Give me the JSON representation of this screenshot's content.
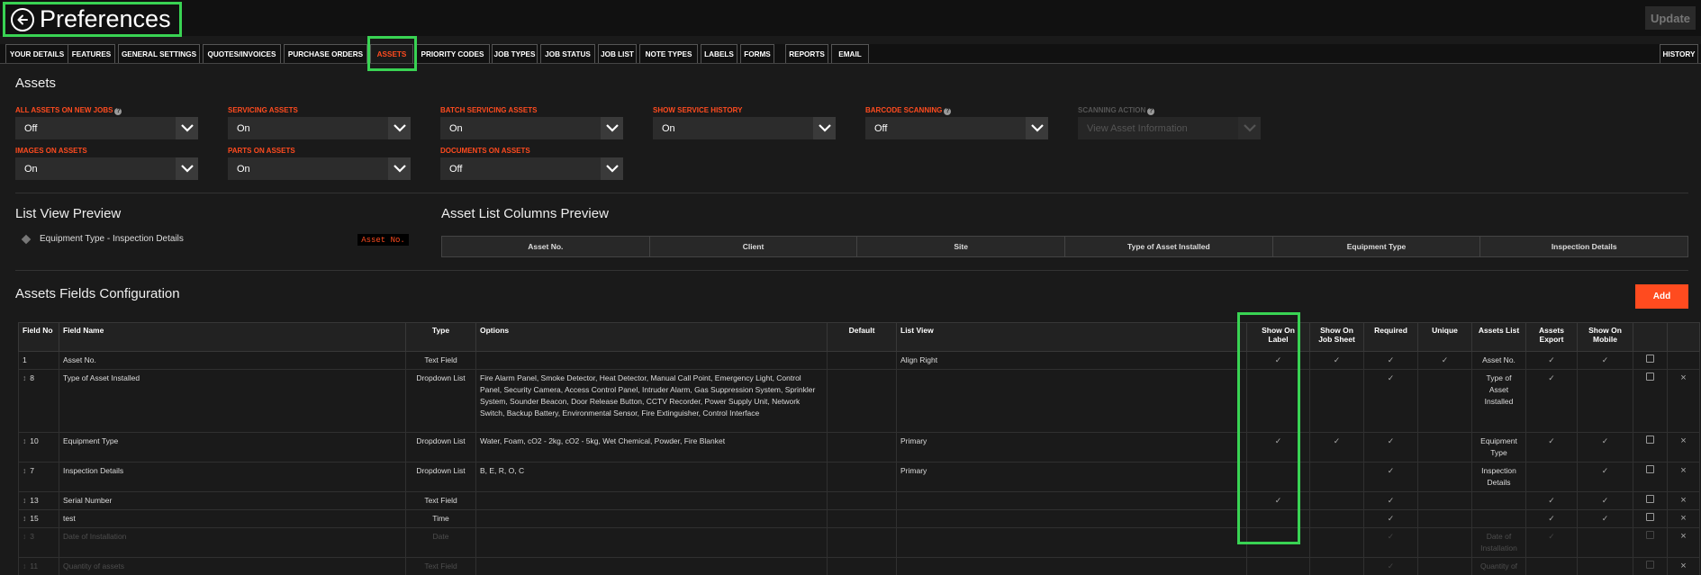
{
  "header": {
    "title": "Preferences",
    "update_label": "Update"
  },
  "tabs": [
    {
      "label": "YOUR DETAILS"
    },
    {
      "label": "FEATURES"
    },
    {
      "label": "GENERAL SETTINGS"
    },
    {
      "label": "QUOTES/INVOICES"
    },
    {
      "label": "PURCHASE ORDERS"
    },
    {
      "label": "ASSETS",
      "active": true
    },
    {
      "label": "PRIORITY CODES"
    },
    {
      "label": "JOB TYPES"
    },
    {
      "label": "JOB STATUS"
    },
    {
      "label": "JOB LIST"
    },
    {
      "label": "NOTE TYPES"
    },
    {
      "label": "LABELS"
    },
    {
      "label": "FORMS"
    },
    {
      "label": "REPORTS"
    },
    {
      "label": "EMAIL"
    }
  ],
  "history_label": "HISTORY",
  "assets_section": {
    "title": "Assets",
    "fields": [
      {
        "label": "ALL ASSETS ON NEW JOBS",
        "value": "Off",
        "help": true
      },
      {
        "label": "SERVICING ASSETS",
        "value": "On"
      },
      {
        "label": "BATCH SERVICING ASSETS",
        "value": "On"
      },
      {
        "label": "SHOW SERVICE HISTORY",
        "value": "On"
      },
      {
        "label": "BARCODE SCANNING",
        "value": "Off",
        "help": true
      },
      {
        "label": "SCANNING ACTION",
        "value": "View Asset Information",
        "help": true,
        "disabled": true
      },
      {
        "label": "IMAGES ON ASSETS",
        "value": "On"
      },
      {
        "label": "PARTS ON ASSETS",
        "value": "On"
      },
      {
        "label": "DOCUMENTS ON ASSETS",
        "value": "Off"
      }
    ]
  },
  "list_view_preview": {
    "title": "List View Preview",
    "item_text": "Equipment Type - Inspection Details",
    "badge": "Asset No."
  },
  "columns_preview": {
    "title": "Asset List Columns Preview",
    "columns": [
      "Asset No.",
      "Client",
      "Site",
      "Type of Asset Installed",
      "Equipment Type",
      "Inspection Details"
    ]
  },
  "config": {
    "title": "Assets Fields Configuration",
    "add_label": "Add",
    "headers": {
      "field_no": "Field No",
      "field_name": "Field Name",
      "type": "Type",
      "options": "Options",
      "default": "Default",
      "list_view": "List View",
      "show_on_label": "Show On Label",
      "show_on_job_sheet": "Show On Job Sheet",
      "required": "Required",
      "unique": "Unique",
      "assets_list": "Assets List",
      "assets_export": "Assets Export",
      "show_on_mobile": "Show On Mobile"
    },
    "rows": [
      {
        "no": "1",
        "name": "Asset No.",
        "type": "Text Field",
        "options": "",
        "default": "",
        "list_view": "Align Right",
        "label": true,
        "job_sheet": true,
        "required": true,
        "unique": true,
        "assets_list": "Asset No.",
        "export": true,
        "mobile": true,
        "drag": false,
        "delete": false,
        "dim": false
      },
      {
        "no": "8",
        "name": "Type of Asset Installed",
        "type": "Dropdown List",
        "options": "Fire Alarm Panel, Smoke Detector, Heat Detector, Manual Call Point, Emergency Light, Control Panel, Security Camera, Access Control Panel, Intruder Alarm, Gas Suppression System, Sprinkler System, Sounder Beacon, Door Release Button, CCTV Recorder, Power Supply Unit, Network Switch, Backup Battery, Environmental Sensor, Fire Extinguisher, Control Interface",
        "default": "",
        "list_view": "",
        "label": false,
        "job_sheet": false,
        "required": true,
        "unique": false,
        "assets_list": "Type of Asset Installed",
        "export": true,
        "mobile": false,
        "drag": true,
        "delete": true,
        "dim": false
      },
      {
        "no": "10",
        "name": "Equipment Type",
        "type": "Dropdown List",
        "options": "Water, Foam, cO2 - 2kg, cO2 - 5kg, Wet Chemical, Powder, Fire Blanket",
        "default": "",
        "list_view": "Primary",
        "label": true,
        "job_sheet": true,
        "required": true,
        "unique": false,
        "assets_list": "Equipment Type",
        "export": true,
        "mobile": true,
        "drag": true,
        "delete": true,
        "dim": false
      },
      {
        "no": "7",
        "name": "Inspection Details",
        "type": "Dropdown List",
        "options": "B, E, R, O, C",
        "default": "",
        "list_view": "Primary",
        "label": false,
        "job_sheet": false,
        "required": true,
        "unique": false,
        "assets_list": "Inspection Details",
        "export": false,
        "mobile": true,
        "drag": true,
        "delete": true,
        "dim": false
      },
      {
        "no": "13",
        "name": "Serial Number",
        "type": "Text Field",
        "options": "",
        "default": "",
        "list_view": "",
        "label": true,
        "job_sheet": false,
        "required": true,
        "unique": false,
        "assets_list": "",
        "export": true,
        "mobile": true,
        "drag": true,
        "delete": true,
        "dim": false
      },
      {
        "no": "15",
        "name": "test",
        "type": "Time",
        "options": "",
        "default": "",
        "list_view": "",
        "label": false,
        "job_sheet": false,
        "required": true,
        "unique": false,
        "assets_list": "",
        "export": true,
        "mobile": true,
        "drag": true,
        "delete": true,
        "dim": false
      },
      {
        "no": "3",
        "name": "Date of Installation",
        "type": "Date",
        "options": "",
        "default": "",
        "list_view": "",
        "label": false,
        "job_sheet": false,
        "required": true,
        "unique": false,
        "assets_list": "Date of Installation",
        "export": true,
        "mobile": false,
        "drag": true,
        "delete": true,
        "dim": true
      },
      {
        "no": "11",
        "name": "Quantity of assets",
        "type": "Text Field",
        "options": "",
        "default": "",
        "list_view": "",
        "label": false,
        "job_sheet": false,
        "required": true,
        "unique": false,
        "assets_list": "Quantity of assets",
        "export": false,
        "mobile": false,
        "drag": true,
        "delete": true,
        "dim": true
      }
    ]
  }
}
